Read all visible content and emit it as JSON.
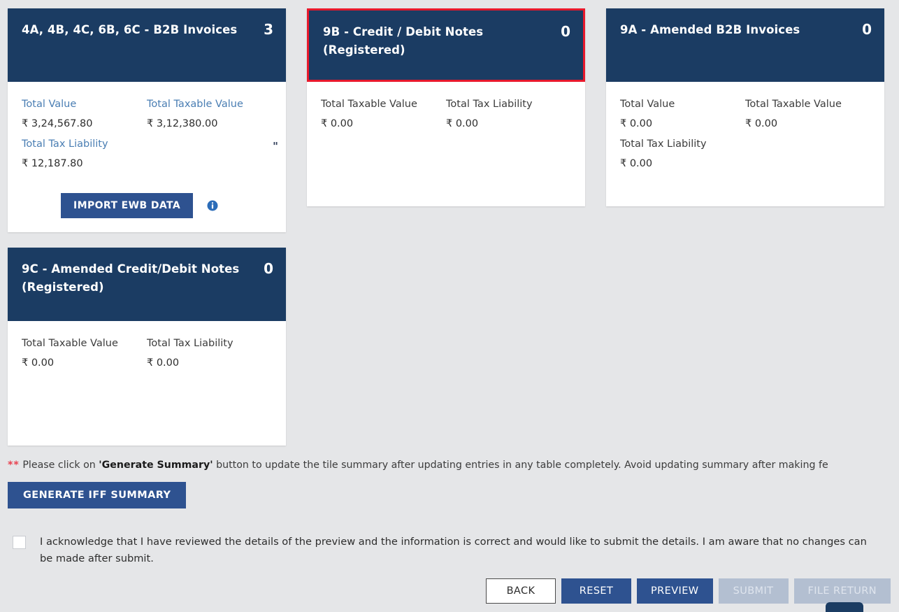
{
  "tiles": [
    {
      "id": "b2b-invoices",
      "title": "4A, 4B, 4C, 6B, 6C - B2B Invoices",
      "count": "3",
      "highlighted": false,
      "label_style": "blue",
      "stats": [
        {
          "label": "Total Value",
          "value": "₹ 3,24,567.80"
        },
        {
          "label": "Total Taxable Value",
          "value": "₹ 3,12,380.00"
        },
        {
          "label": "Total Tax Liability",
          "value": "₹ 12,187.80"
        }
      ],
      "quote_mark": "\"",
      "action_label": "IMPORT EWB DATA",
      "info_icon": "info-icon"
    },
    {
      "id": "credit-debit-notes-registered",
      "title": "9B - Credit / Debit Notes (Registered)",
      "count": "0",
      "highlighted": true,
      "label_style": "dark",
      "stats": [
        {
          "label": "Total Taxable Value",
          "value": "₹ 0.00"
        },
        {
          "label": "Total Tax Liability",
          "value": "₹ 0.00"
        }
      ]
    },
    {
      "id": "amended-b2b-invoices",
      "title": "9A - Amended B2B Invoices",
      "count": "0",
      "highlighted": false,
      "label_style": "dark",
      "stats": [
        {
          "label": "Total Value",
          "value": "₹ 0.00"
        },
        {
          "label": "Total Taxable Value",
          "value": "₹ 0.00"
        },
        {
          "label": "Total Tax Liability",
          "value": "₹ 0.00"
        }
      ]
    },
    {
      "id": "amended-credit-debit-notes-registered",
      "title": "9C - Amended Credit/Debit Notes (Registered)",
      "count": "0",
      "highlighted": false,
      "label_style": "dark",
      "stats": [
        {
          "label": "Total Taxable Value",
          "value": "₹ 0.00"
        },
        {
          "label": "Total Tax Liability",
          "value": "₹ 0.00"
        }
      ]
    }
  ],
  "note": {
    "stars": "**",
    "part1": " Please click on ",
    "bold": "'Generate Summary'",
    "part2": " button to update the tile summary after updating entries in any table completely. Avoid updating summary after making fe"
  },
  "generate_button": "GENERATE IFF SUMMARY",
  "acknowledge": {
    "text": "I acknowledge that I have reviewed the details of the preview and the information is correct and would like to submit the details. I am aware that no changes can be made after submit.",
    "checked": false
  },
  "footer_buttons": [
    {
      "label": "BACK",
      "style": "light",
      "disabled": false
    },
    {
      "label": "RESET",
      "style": "primary",
      "disabled": false
    },
    {
      "label": "PREVIEW",
      "style": "primary",
      "disabled": false
    },
    {
      "label": "SUBMIT",
      "style": "disabled",
      "disabled": true
    },
    {
      "label": "FILE RETURN",
      "style": "disabled",
      "disabled": true
    }
  ],
  "colors": {
    "header_blue": "#1b3c63",
    "button_blue": "#2e5290",
    "highlight_red": "#e8192c",
    "label_blue": "#4a7eb3",
    "page_bg": "#e5e6e8",
    "disabled_bg": "#b3bfd1"
  }
}
